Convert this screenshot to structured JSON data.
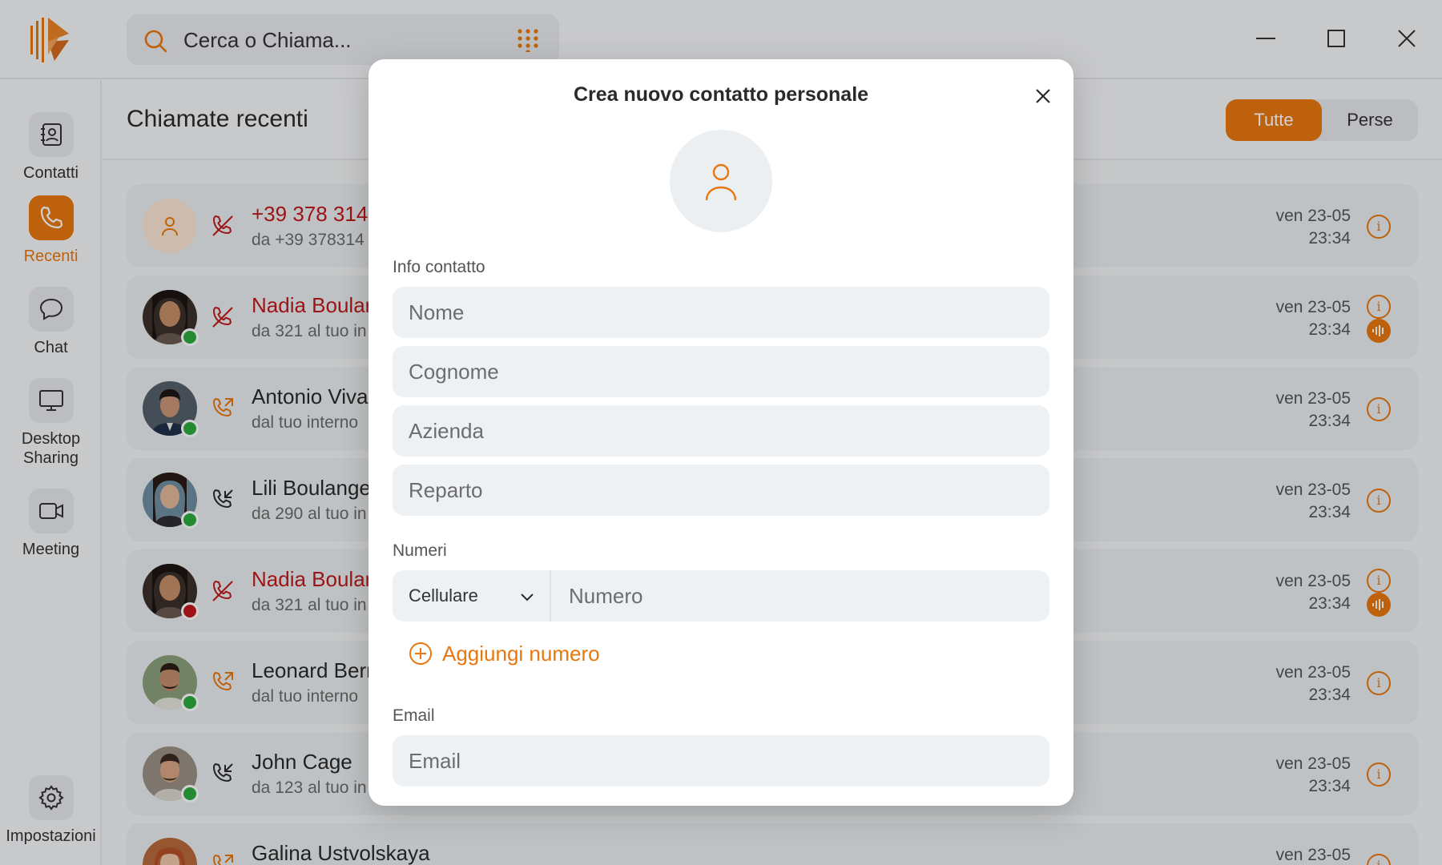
{
  "app": {
    "search_placeholder": "Cerca o Chiama...",
    "colors": {
      "accent": "#e8770f",
      "missed": "#c0191c",
      "online": "#2eaa3f",
      "busy": "#c0191c"
    }
  },
  "sidebar": {
    "items": [
      {
        "label": "Contatti",
        "icon": "address-book-icon"
      },
      {
        "label": "Recenti",
        "icon": "phone-icon"
      },
      {
        "label": "Chat",
        "icon": "chat-bubble-icon"
      },
      {
        "label": "Desktop Sharing",
        "icon": "monitor-icon"
      },
      {
        "label": "Meeting",
        "icon": "video-camera-icon"
      }
    ],
    "settings_label": "Impostazioni"
  },
  "main": {
    "title": "Chiamate recenti",
    "filters": {
      "all": "Tutte",
      "missed": "Perse"
    },
    "calls": [
      {
        "name": "+39 378 314",
        "sub": "da +39 378314",
        "date": "ven 23-05",
        "time": "23:34",
        "direction": "missed",
        "status": "none"
      },
      {
        "name": "Nadia Boular",
        "sub": "da 321 al tuo in",
        "date": "ven 23-05",
        "time": "23:34",
        "direction": "missed",
        "status": "online"
      },
      {
        "name": "Antonio Viva",
        "sub": "dal tuo interno",
        "date": "ven 23-05",
        "time": "23:34",
        "direction": "outgoing",
        "status": "online"
      },
      {
        "name": "Lili Boulange",
        "sub": "da 290 al tuo in",
        "date": "ven 23-05",
        "time": "23:34",
        "direction": "incoming",
        "status": "online"
      },
      {
        "name": "Nadia Boular",
        "sub": "da 321 al tuo in",
        "date": "ven 23-05",
        "time": "23:34",
        "direction": "missed",
        "status": "busy"
      },
      {
        "name": "Leonard Bern",
        "sub": "dal tuo interno",
        "date": "ven 23-05",
        "time": "23:34",
        "direction": "outgoing",
        "status": "online"
      },
      {
        "name": "John Cage",
        "sub": "da 123 al tuo in",
        "date": "ven 23-05",
        "time": "23:34",
        "direction": "incoming",
        "status": "online"
      },
      {
        "name": "Galina Ustvolskaya",
        "sub": "",
        "date": "ven 23-05",
        "time": "",
        "direction": "outgoing",
        "status": "none"
      }
    ]
  },
  "modal": {
    "title": "Crea nuovo contatto personale",
    "info_label": "Info contatto",
    "placeholders": {
      "first_name": "Nome",
      "last_name": "Cognome",
      "company": "Azienda",
      "department": "Reparto",
      "number": "Numero",
      "email": "Email"
    },
    "numbers_label": "Numeri",
    "number_type": "Cellulare",
    "add_number": "Aggiungi numero",
    "email_label": "Email"
  }
}
